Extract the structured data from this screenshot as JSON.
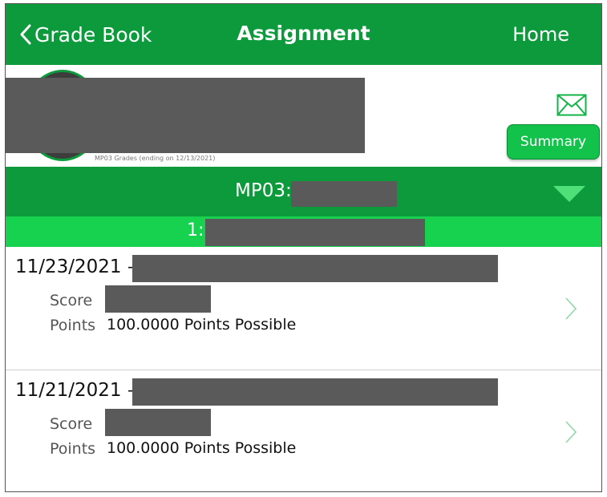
{
  "navbar": {
    "back_label": "Grade Book",
    "title": "Assignment",
    "home_label": "Home"
  },
  "profile": {
    "caption": "MP03 Grades (ending on 12/13/2021)",
    "summary_label": "Summary"
  },
  "marking_period": {
    "label": "MP03:"
  },
  "class_row": {
    "label": "1:"
  },
  "assignments": [
    {
      "date": "11/23/2021 –",
      "score_label": "Score",
      "points_label": "Points",
      "points_value": "100.0000 Points Possible"
    },
    {
      "date": "11/21/2021 –",
      "score_label": "Score",
      "points_label": "Points",
      "points_value": "100.0000 Points Possible"
    }
  ],
  "colors": {
    "brand_green": "#0d9a3c",
    "accent_green": "#16d24f",
    "redaction": "#5a5a5a"
  }
}
